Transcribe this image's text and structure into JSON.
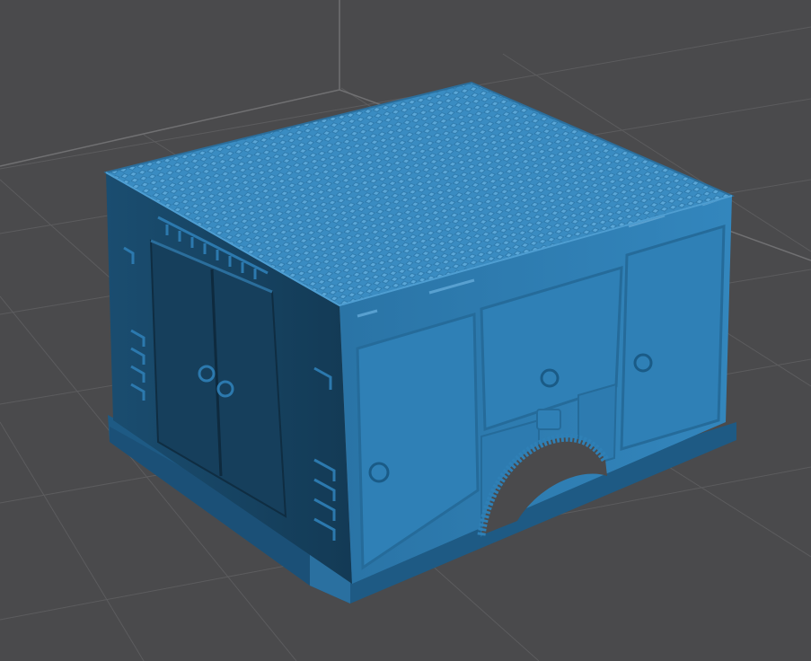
{
  "viewport": {
    "kind": "3d-model-preview",
    "background_color": "#4a4a4c",
    "grid_color": "#5a5a5c",
    "grid_axis_color": "#6a6a6c"
  },
  "model": {
    "name": "utility-truck-body",
    "base_color": "#2f7eb4",
    "top_color": "#3a8cc2",
    "front_color": "#2c79ae",
    "side_color": "#153e5a",
    "plinth_color": "#1e5a84",
    "features": [
      "diamond-plate-top",
      "double-rear-doors",
      "side-compartment-doors",
      "wheel-arch",
      "side-ladder-rungs",
      "round-door-handles"
    ]
  }
}
